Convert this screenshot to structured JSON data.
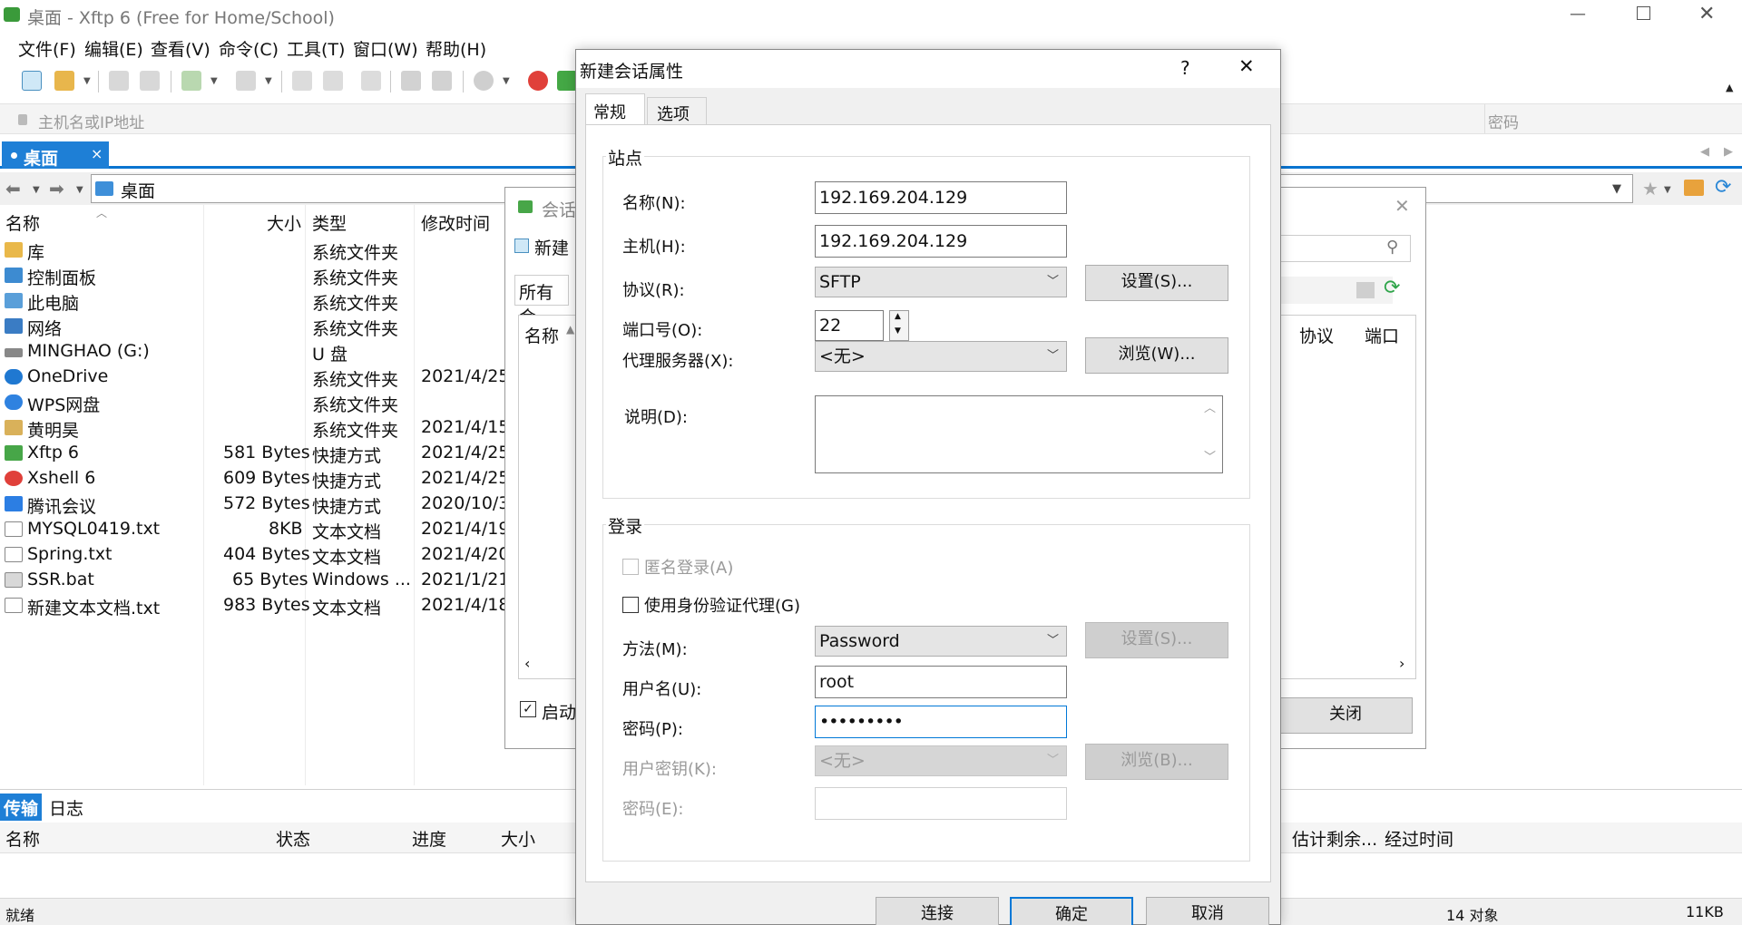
{
  "window": {
    "title": "桌面 - Xftp 6 (Free for Home/School)"
  },
  "menu": [
    "文件(F)",
    "编辑(E)",
    "查看(V)",
    "命令(C)",
    "工具(T)",
    "窗口(W)",
    "帮助(H)"
  ],
  "address_bar": {
    "host_placeholder": "主机名或IP地址",
    "password_placeholder": "密码"
  },
  "tab": {
    "label": "桌面",
    "close": "×"
  },
  "path": {
    "value": "桌面"
  },
  "file_list": {
    "columns": [
      "名称",
      "大小",
      "类型",
      "修改时间"
    ],
    "rows": [
      {
        "name": "库",
        "size": "",
        "type": "系统文件夹",
        "modified": ""
      },
      {
        "name": "控制面板",
        "size": "",
        "type": "系统文件夹",
        "modified": ""
      },
      {
        "name": "此电脑",
        "size": "",
        "type": "系统文件夹",
        "modified": ""
      },
      {
        "name": "网络",
        "size": "",
        "type": "系统文件夹",
        "modified": ""
      },
      {
        "name": "MINGHAO (G:)",
        "size": "",
        "type": "U 盘",
        "modified": ""
      },
      {
        "name": "OneDrive",
        "size": "",
        "type": "系统文件夹",
        "modified": "2021/4/25"
      },
      {
        "name": "WPS网盘",
        "size": "",
        "type": "系统文件夹",
        "modified": ""
      },
      {
        "name": "黄明昊",
        "size": "",
        "type": "系统文件夹",
        "modified": "2021/4/15"
      },
      {
        "name": "Xftp 6",
        "size": "581 Bytes",
        "type": "快捷方式",
        "modified": "2021/4/25"
      },
      {
        "name": "Xshell 6",
        "size": "609 Bytes",
        "type": "快捷方式",
        "modified": "2021/4/25"
      },
      {
        "name": "腾讯会议",
        "size": "572 Bytes",
        "type": "快捷方式",
        "modified": "2020/10/3"
      },
      {
        "name": "MYSQL0419.txt",
        "size": "8KB",
        "type": "文本文档",
        "modified": "2021/4/19"
      },
      {
        "name": "Spring.txt",
        "size": "404 Bytes",
        "type": "文本文档",
        "modified": "2021/4/20"
      },
      {
        "name": "SSR.bat",
        "size": "65 Bytes",
        "type": "Windows ...",
        "modified": "2021/1/21"
      },
      {
        "name": "新建文本文档.txt",
        "size": "983 Bytes",
        "type": "文本文档",
        "modified": "2021/4/18"
      }
    ]
  },
  "session_dialog_bg": {
    "title": "会话",
    "new_label": "新建",
    "all_sessions": "所有会",
    "col_name": "名称",
    "col_protocol": "协议",
    "col_port": "端口",
    "startup_label": "启动",
    "close_button": "关闭"
  },
  "transfer": {
    "tabs": [
      "传输",
      "日志"
    ],
    "columns": [
      "名称",
      "状态",
      "进度",
      "大小",
      "估计剩余...",
      "经过时间"
    ]
  },
  "status_bar": {
    "left": "就绪",
    "count": "14 对象",
    "size": "11KB"
  },
  "dialog": {
    "title": "新建会话属性",
    "help": "?",
    "close": "✕",
    "tabs": [
      "常规",
      "选项"
    ],
    "site_group": "站点",
    "name_label": "名称(N):",
    "name_value": "192.169.204.129",
    "host_label": "主机(H):",
    "host_value": "192.169.204.129",
    "protocol_label": "协议(R):",
    "protocol_value": "SFTP",
    "settings_button": "设置(S)...",
    "port_label": "端口号(O):",
    "port_value": "22",
    "proxy_label": "代理服务器(X):",
    "proxy_value": "<无>",
    "browse_button": "浏览(W)...",
    "desc_label": "说明(D):",
    "login_group": "登录",
    "anonymous_label": "匿名登录(A)",
    "agent_label": "使用身份验证代理(G)",
    "method_label": "方法(M):",
    "method_value": "Password",
    "method_settings_button": "设置(S)...",
    "user_label": "用户名(U):",
    "user_value": "root",
    "password_label": "密码(P):",
    "password_value": "•••••••••",
    "userkey_label": "用户密钥(K):",
    "userkey_value": "<无>",
    "userkey_browse_button": "浏览(B)...",
    "passphrase_label": "密码(E):",
    "connect_button": "连接",
    "ok_button": "确定",
    "cancel_button": "取消"
  }
}
